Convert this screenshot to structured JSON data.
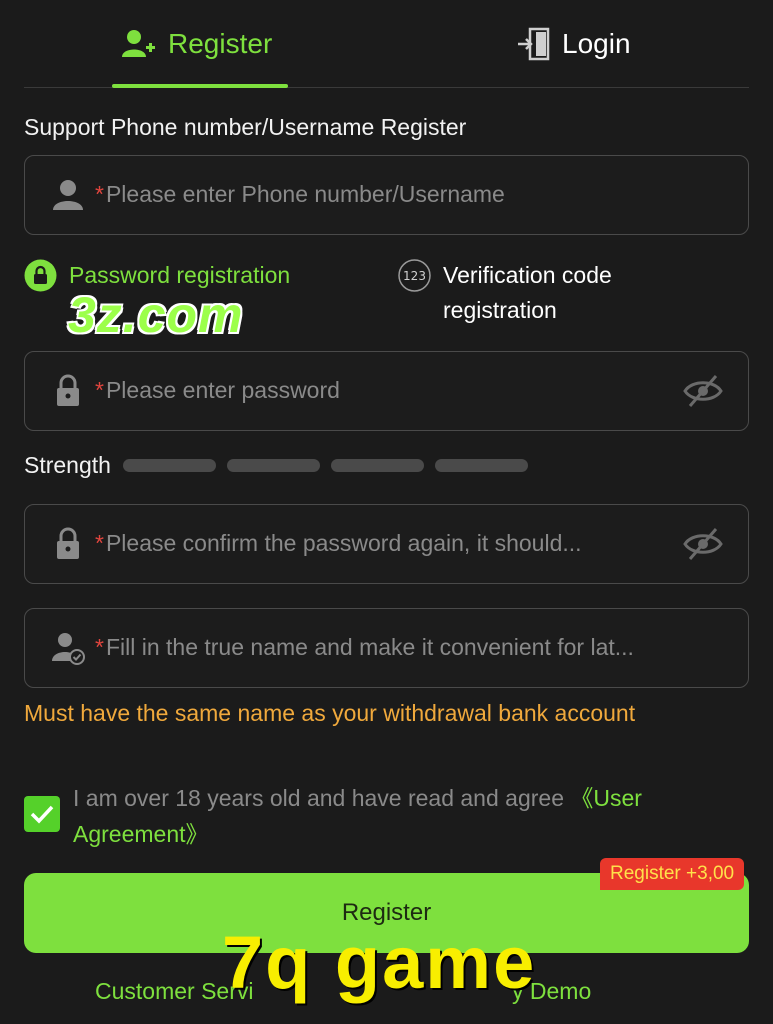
{
  "tabs": {
    "register_label": "Register",
    "login_label": "Login"
  },
  "section_label": "Support Phone number/Username Register",
  "fields": {
    "username": {
      "required_mark": "*",
      "placeholder": "Please enter Phone number/Username"
    },
    "password": {
      "required_mark": "*",
      "placeholder": "Please enter password"
    },
    "confirm_password": {
      "required_mark": "*",
      "placeholder": "Please confirm the password again, it should..."
    },
    "real_name": {
      "required_mark": "*",
      "placeholder": "Fill in the true name and make it convenient for lat..."
    }
  },
  "modes": {
    "password_label": "Password registration",
    "code_icon_text": "123",
    "code_label": "Verification code registration"
  },
  "watermark_site": "3z.com",
  "strength": {
    "label": "Strength",
    "level": 0
  },
  "name_hint": "Must have the same name as your withdrawal bank account",
  "agreement": {
    "checked": true,
    "text": "I am over 18 years old and have read and agree ",
    "link_label": "《User Agreement》"
  },
  "register_button_label": "Register",
  "bonus_badge": "Register +3,00",
  "footer": {
    "customer_service_label": "Customer Servi",
    "play_demo_label": "y Demo"
  },
  "watermark_game": "7q  game",
  "colors": {
    "accent": "#7ee03e",
    "background": "#1b1b1b",
    "warning": "#f0a93c",
    "badge": "#e8372b"
  }
}
